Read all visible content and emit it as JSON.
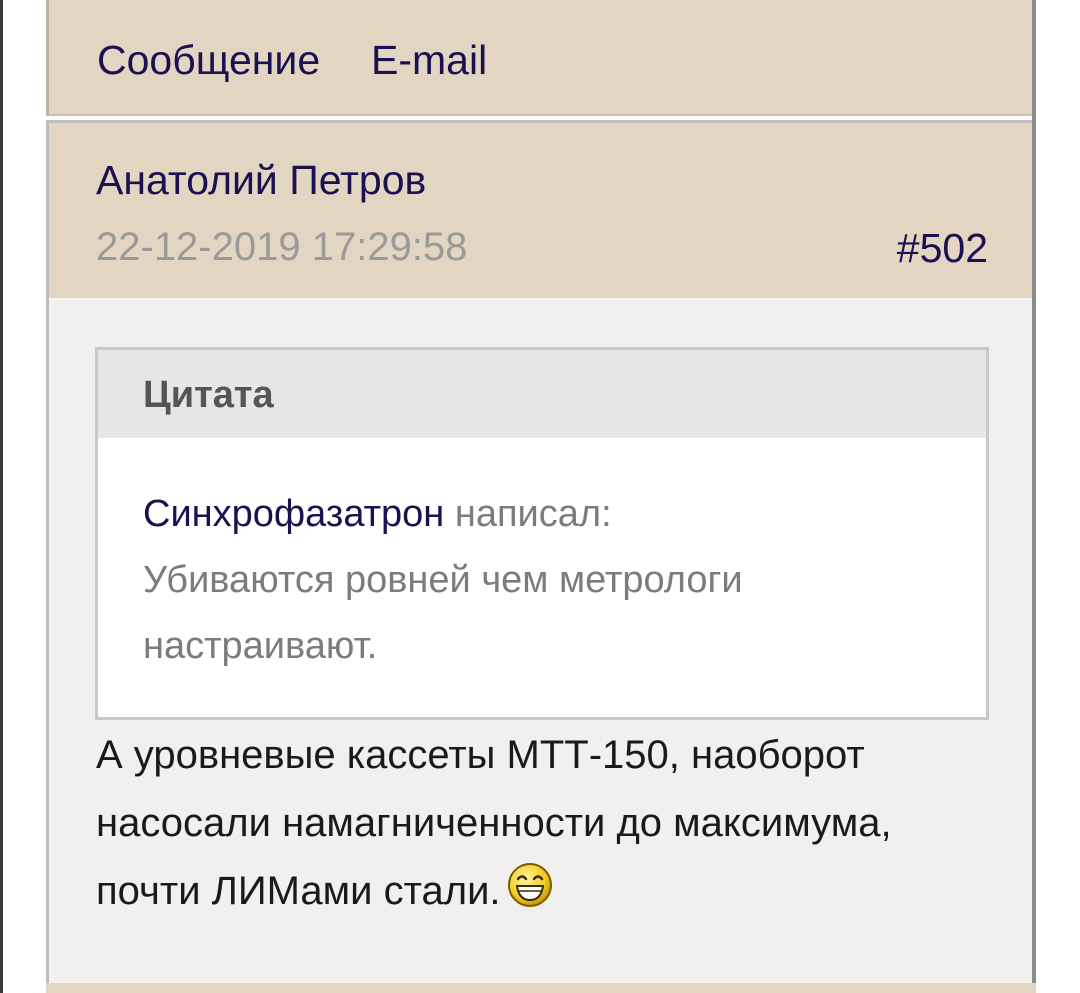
{
  "tabs": {
    "message": "Сообщение",
    "email": "E-mail"
  },
  "post": {
    "author": "Анатолий Петров",
    "date": "22-12-2019 17:29:58",
    "number": "#502",
    "quote": {
      "title": "Цитата",
      "author": "Синхрофазатрон",
      "wrote": "написал:",
      "text": "Убиваются ровней чем метрологи настраивают."
    },
    "body": "А уровневые кассеты МТТ-150, наоборот насосали намагниченности до максимума, почти ЛИМами стали.",
    "emoji": "laughing-smiley-icon"
  },
  "colors": {
    "header_bg": "#e2d5c2",
    "post_bg": "#f1f0ee",
    "link": "#1c1150",
    "muted": "#9a9a9a"
  }
}
